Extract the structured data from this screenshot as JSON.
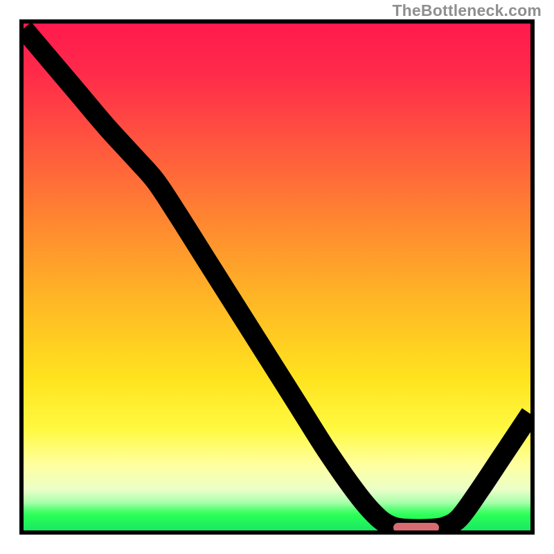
{
  "attribution": "TheBottleneck.com",
  "colors": {
    "frame": "#000000",
    "gradient_stops": [
      {
        "offset": 0.0,
        "color": "#ff1a4d"
      },
      {
        "offset": 0.1,
        "color": "#ff2b4a"
      },
      {
        "offset": 0.25,
        "color": "#ff5a3d"
      },
      {
        "offset": 0.4,
        "color": "#ff8a30"
      },
      {
        "offset": 0.55,
        "color": "#ffb825"
      },
      {
        "offset": 0.7,
        "color": "#ffe31e"
      },
      {
        "offset": 0.8,
        "color": "#fff941"
      },
      {
        "offset": 0.87,
        "color": "#ffffa0"
      },
      {
        "offset": 0.92,
        "color": "#eaffc8"
      },
      {
        "offset": 0.945,
        "color": "#a8ffaa"
      },
      {
        "offset": 0.958,
        "color": "#5aff77"
      },
      {
        "offset": 0.97,
        "color": "#2aff57"
      },
      {
        "offset": 1.0,
        "color": "#18e862"
      }
    ],
    "curve": "#000000",
    "marker": "#d86b6f"
  },
  "chart_data": {
    "type": "line",
    "title": "",
    "xlabel": "",
    "ylabel": "",
    "xlim": [
      0,
      100
    ],
    "ylim": [
      0,
      100
    ],
    "curve_points": [
      {
        "x": 0.0,
        "y": 99.0
      },
      {
        "x": 5.5,
        "y": 92.5
      },
      {
        "x": 11.0,
        "y": 86.0
      },
      {
        "x": 16.5,
        "y": 79.5
      },
      {
        "x": 22.0,
        "y": 73.5
      },
      {
        "x": 26.0,
        "y": 69.0
      },
      {
        "x": 30.0,
        "y": 63.0
      },
      {
        "x": 36.0,
        "y": 53.5
      },
      {
        "x": 42.0,
        "y": 44.0
      },
      {
        "x": 48.0,
        "y": 34.5
      },
      {
        "x": 54.0,
        "y": 25.0
      },
      {
        "x": 60.0,
        "y": 15.5
      },
      {
        "x": 66.0,
        "y": 7.0
      },
      {
        "x": 70.0,
        "y": 2.5
      },
      {
        "x": 73.0,
        "y": 0.7
      },
      {
        "x": 76.0,
        "y": 0.3
      },
      {
        "x": 80.0,
        "y": 0.3
      },
      {
        "x": 83.0,
        "y": 0.7
      },
      {
        "x": 86.0,
        "y": 2.5
      },
      {
        "x": 90.0,
        "y": 8.0
      },
      {
        "x": 94.0,
        "y": 14.0
      },
      {
        "x": 98.0,
        "y": 20.0
      },
      {
        "x": 100.0,
        "y": 23.0
      }
    ],
    "optimal_range": {
      "x_start": 73.0,
      "x_end": 82.0,
      "y": 0.6
    },
    "annotations": []
  }
}
